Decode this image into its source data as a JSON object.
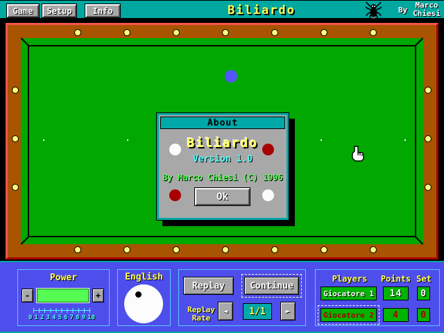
{
  "header": {
    "menu": [
      {
        "label": "Game"
      },
      {
        "label": "Setup"
      },
      {
        "label": "Info"
      }
    ],
    "title": "Biliardo",
    "by_label": "By",
    "author_line1": "Marco",
    "author_line2": "Chiesi"
  },
  "dialog": {
    "title": "About",
    "app_name": "Biliardo",
    "version": "Version 1.0",
    "credit": "By Marco Chiesi (C) 1996",
    "ok_label": "Ok"
  },
  "power": {
    "label": "Power",
    "minus_label": "-",
    "plus_label": "+",
    "value_percent": 100,
    "ticks": [
      "0",
      "1",
      "2",
      "3",
      "4",
      "5",
      "6",
      "7",
      "8",
      "9",
      "10"
    ]
  },
  "english": {
    "label": "English"
  },
  "replay": {
    "replay_label": "Replay",
    "continue_label": "Continue",
    "rate_line1": "Replay",
    "rate_line2": "Rate",
    "prev_icon": "◄",
    "next_icon": "►",
    "rate_value": "1/1"
  },
  "players": {
    "headers": {
      "players": "Players",
      "points": "Points",
      "set": "Set"
    },
    "rows": [
      {
        "name": "Giocatore 1",
        "points": "14",
        "set": "0",
        "active": false
      },
      {
        "name": "Giocatore 2",
        "points": "4",
        "set": "0",
        "active": true
      }
    ]
  },
  "colors": {
    "header_teal": "#00A8A0",
    "panel_blue": "#4E4EEC",
    "panel_border": "#55CCFF",
    "felt_green": "#00A800",
    "rail_brown": "#A85400",
    "frame_light": "#F8544C",
    "frame_dark": "#A80000",
    "accent_yellow": "#FFFF55",
    "accent_cyan": "#55FFFF",
    "accent_green": "#55FF55",
    "ball_blue": "#5555FF",
    "ball_red": "#A80000",
    "score_green": "#00B400",
    "button_gray": "#A8A8A8"
  }
}
